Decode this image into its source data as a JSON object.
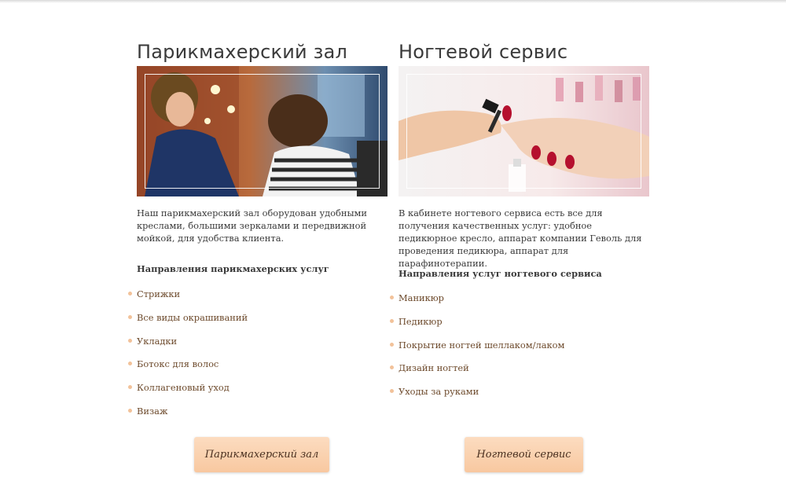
{
  "hair": {
    "title": "Парикмахерский зал",
    "description": "Наш парикмахерский зал оборудован удобными креслами, большими зеркалами и передвижной мойкой, для удобства клиента.",
    "list_heading": "Направления парикмахерских услуг",
    "items": [
      "Стрижки",
      "Все виды окрашиваний",
      "Укладки",
      "Ботокс для волос",
      "Коллагеновый уход",
      "Визаж"
    ],
    "button_label": "Парикмахерский зал"
  },
  "nails": {
    "title": "Ногтевой сервис",
    "description": "В кабинете ногтевого сервиса есть все для получения качественных услуг: удобное педикюрное кресло, аппарат компании Геволь для проведения педикюра, аппарат для парафинотерапии.",
    "list_heading": "Направления услуг ногтевого сервиса",
    "items": [
      "Маникюр",
      "Педикюр",
      "Покрытие ногтей шеллаком/лаком",
      "Дизайн ногтей",
      "Уходы за руками"
    ],
    "button_label": "Ногтевой сервис"
  },
  "colors": {
    "accent": "#f8c8a0",
    "link_text": "#6d4a2c",
    "bullet": "#f2c29a"
  }
}
